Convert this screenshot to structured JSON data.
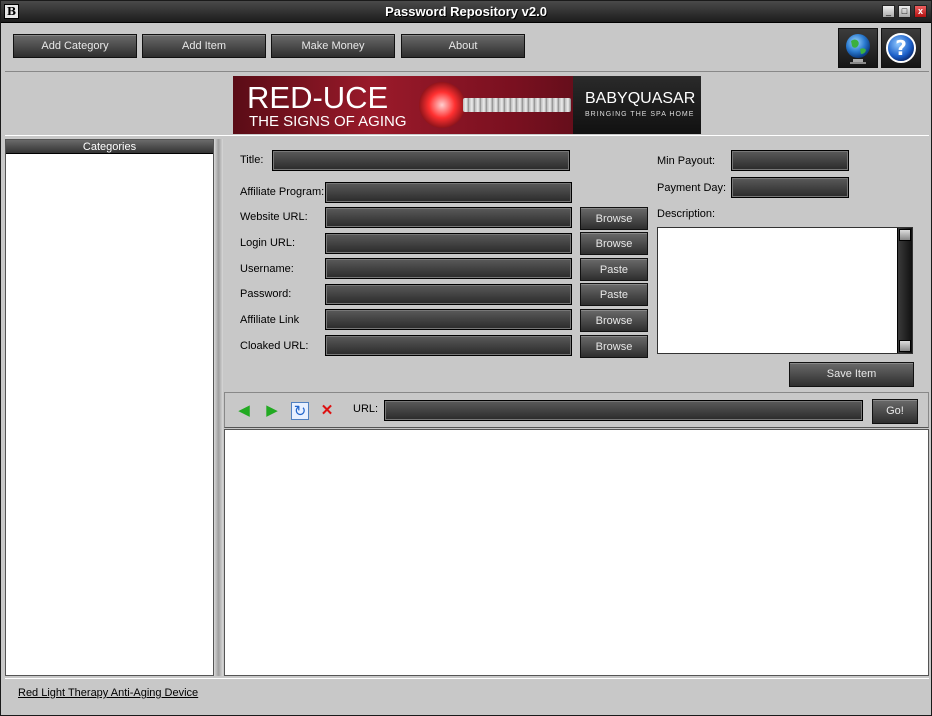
{
  "window": {
    "title": "Password Repository v2.0",
    "icon_letter": "B",
    "min_glyph": "_",
    "max_glyph": "□",
    "close_glyph": "x"
  },
  "toolbar": {
    "add_category": "Add Category",
    "add_item": "Add Item",
    "make_money": "Make Money",
    "about": "About",
    "globe_icon": "globe-icon",
    "help_icon": "help-icon"
  },
  "banner": {
    "title": "RED-UCE",
    "subtitle": "THE SIGNS OF AGING",
    "brand": "BABYQUASAR",
    "tagline": "BRINGING THE SPA HOME"
  },
  "categories": {
    "header": "Categories",
    "items": []
  },
  "form": {
    "title_label": "Title:",
    "title_value": "",
    "affiliate_program_label": "Affiliate Program:",
    "affiliate_program_value": "",
    "website_url_label": "Website URL:",
    "website_url_value": "",
    "login_url_label": "Login URL:",
    "login_url_value": "",
    "username_label": "Username:",
    "username_value": "",
    "password_label": "Password:",
    "password_value": "",
    "affiliate_link_label": "Affiliate Link",
    "affiliate_link_value": "",
    "cloaked_url_label": "Cloaked URL:",
    "cloaked_url_value": "",
    "min_payout_label": "Min Payout:",
    "min_payout_value": "",
    "payment_day_label": "Payment Day:",
    "payment_day_value": "",
    "description_label": "Description:",
    "description_value": "",
    "browse": "Browse",
    "paste": "Paste",
    "save_item": "Save Item"
  },
  "browser": {
    "url_label": "URL:",
    "url_value": "",
    "go": "Go!",
    "back_glyph": "◀",
    "forward_glyph": "▶",
    "refresh_glyph": "↻",
    "stop_glyph": "✕",
    "icon_colors": {
      "nav": "#22aa22",
      "refresh": "#2266cc",
      "stop": "#dd1111"
    }
  },
  "footer": {
    "link": "Red Light Therapy Anti-Aging Device"
  }
}
